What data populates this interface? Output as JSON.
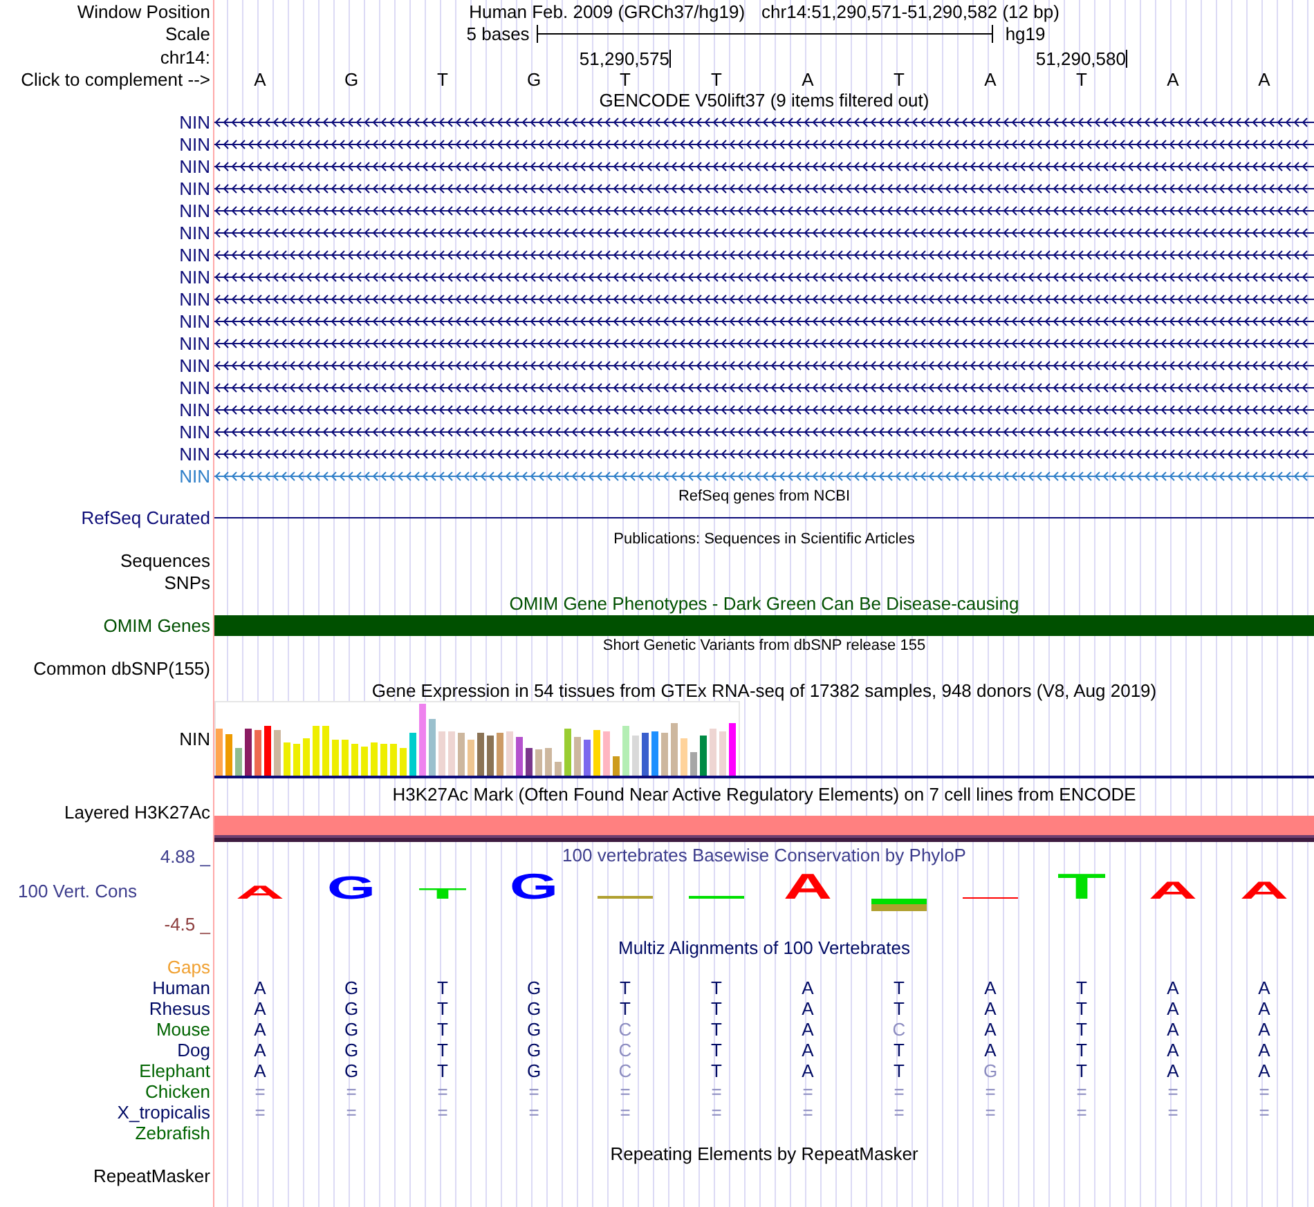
{
  "ruler": {
    "window_label": "Window Position",
    "assembly": "Human Feb. 2009 (GRCh37/hg19)",
    "range": "chr14:51,290,571-51,290,582 (12 bp)",
    "scale_label": "Scale",
    "scale_text": "5 bases",
    "scale_assembly": "hg19",
    "chrom_label": "chr14:",
    "positions": [
      "51,290,575",
      "51,290,580"
    ],
    "bases_label": "Click to complement -->",
    "bases": [
      "A",
      "G",
      "T",
      "G",
      "T",
      "T",
      "A",
      "T",
      "A",
      "T",
      "A",
      "A"
    ]
  },
  "tracks": [
    {
      "kind": "gene_stack",
      "title": "GENCODE V50lift37 (9 items filtered out)",
      "color": "#000000",
      "items": [
        {
          "label": "NIN",
          "color": "#0c0c78"
        },
        {
          "label": "NIN",
          "color": "#0c0c78"
        },
        {
          "label": "NIN",
          "color": "#0c0c78"
        },
        {
          "label": "NIN",
          "color": "#0c0c78"
        },
        {
          "label": "NIN",
          "color": "#0c0c78"
        },
        {
          "label": "NIN",
          "color": "#0c0c78"
        },
        {
          "label": "NIN",
          "color": "#0c0c78"
        },
        {
          "label": "NIN",
          "color": "#0c0c78"
        },
        {
          "label": "NIN",
          "color": "#0c0c78"
        },
        {
          "label": "NIN",
          "color": "#0c0c78"
        },
        {
          "label": "NIN",
          "color": "#0c0c78"
        },
        {
          "label": "NIN",
          "color": "#0c0c78"
        },
        {
          "label": "NIN",
          "color": "#0c0c78"
        },
        {
          "label": "NIN",
          "color": "#0c0c78"
        },
        {
          "label": "NIN",
          "color": "#0c0c78"
        },
        {
          "label": "NIN",
          "color": "#0c0c78"
        },
        {
          "label": "NIN",
          "color": "#2f7fc8"
        }
      ]
    },
    {
      "kind": "gene_line",
      "title": "RefSeq genes from NCBI",
      "label": "RefSeq Curated",
      "color": "#0c0c78"
    },
    {
      "kind": "label_stack",
      "title": "Publications: Sequences in Scientific Articles",
      "labels": [
        "Sequences",
        "SNPs"
      ],
      "color": "#000000"
    },
    {
      "kind": "feature_bar",
      "title": "OMIM Gene Phenotypes - Dark Green Can Be Disease-causing",
      "label": "OMIM Genes",
      "color": "#005000"
    },
    {
      "kind": "variants",
      "title": "Short Genetic Variants from dbSNP release 155",
      "label": "Common dbSNP(155)",
      "color": "#000000"
    },
    {
      "kind": "bar_chart",
      "title": "Gene Expression in 54 tissues from GTEx RNA-seq of 17382 samples, 948 donors (V8, Aug 2019)",
      "label": "NIN",
      "color": "#000000"
    },
    {
      "kind": "layered_signal",
      "title": "H3K27Ac Mark (Often Found Near Active Regulatory Elements) on 7 cell lines from ENCODE",
      "label": "Layered H3K27Ac",
      "color": "#000000"
    },
    {
      "kind": "logo",
      "title": "100 vertebrates Basewise Conservation by PhyloP",
      "label": "100 Vert. Cons",
      "color": "#3c3c8c",
      "ymax": "4.88 _",
      "ymin": "-4.5 _",
      "columns": [
        {
          "above": [
            {
              "kind": "letter",
              "base": "A",
              "color": "#ff0000"
            }
          ]
        },
        {
          "above": [
            {
              "kind": "letter",
              "base": "G",
              "color": "#0000ff"
            }
          ]
        },
        {
          "above": [
            {
              "kind": "letter",
              "base": "T",
              "color": "#00e000"
            }
          ]
        },
        {
          "above": [
            {
              "kind": "letter",
              "base": "G",
              "color": "#0000ff"
            }
          ]
        },
        {
          "above": [
            {
              "kind": "sliver",
              "color": "#b0a030"
            }
          ]
        },
        {
          "above": [
            {
              "kind": "sliver",
              "color": "#00e000"
            }
          ]
        },
        {
          "above": [
            {
              "kind": "letter",
              "base": "A",
              "color": "#ff0000"
            }
          ]
        },
        {
          "below": [
            {
              "kind": "sliver",
              "color": "#00e000"
            },
            {
              "kind": "sliver",
              "color": "#b0a030"
            }
          ]
        },
        {
          "above": [
            {
              "kind": "sliver",
              "color": "#ff0000"
            }
          ]
        },
        {
          "above": [
            {
              "kind": "letter",
              "base": "T",
              "color": "#00e000"
            }
          ]
        },
        {
          "above": [
            {
              "kind": "letter",
              "base": "A",
              "color": "#ff0000"
            }
          ]
        },
        {
          "above": [
            {
              "kind": "letter",
              "base": "A",
              "color": "#ff0000"
            }
          ]
        }
      ]
    },
    {
      "kind": "alignment",
      "title": "Multiz Alignments of 100 Vertebrates",
      "color": "#000a64",
      "rows": [
        {
          "label": "Gaps",
          "color": "#f0a030"
        },
        {
          "label": "Human",
          "color": "#000a64",
          "bases": [
            {
              "base": "A",
              "greyed": false
            },
            {
              "base": "G",
              "greyed": false
            },
            {
              "base": "T",
              "greyed": false
            },
            {
              "base": "G",
              "greyed": false
            },
            {
              "base": "T",
              "greyed": false
            },
            {
              "base": "T",
              "greyed": false
            },
            {
              "base": "A",
              "greyed": false
            },
            {
              "base": "T",
              "greyed": false
            },
            {
              "base": "A",
              "greyed": false
            },
            {
              "base": "T",
              "greyed": false
            },
            {
              "base": "A",
              "greyed": false
            },
            {
              "base": "A",
              "greyed": false
            }
          ]
        },
        {
          "label": "Rhesus",
          "color": "#000a64",
          "bases": [
            {
              "base": "A",
              "greyed": false
            },
            {
              "base": "G",
              "greyed": false
            },
            {
              "base": "T",
              "greyed": false
            },
            {
              "base": "G",
              "greyed": false
            },
            {
              "base": "T",
              "greyed": false
            },
            {
              "base": "T",
              "greyed": false
            },
            {
              "base": "A",
              "greyed": false
            },
            {
              "base": "T",
              "greyed": false
            },
            {
              "base": "A",
              "greyed": false
            },
            {
              "base": "T",
              "greyed": false
            },
            {
              "base": "A",
              "greyed": false
            },
            {
              "base": "A",
              "greyed": false
            }
          ]
        },
        {
          "label": "Mouse",
          "color": "#006400",
          "bases": [
            {
              "base": "A",
              "greyed": false
            },
            {
              "base": "G",
              "greyed": false
            },
            {
              "base": "T",
              "greyed": false
            },
            {
              "base": "G",
              "greyed": false
            },
            {
              "base": "C",
              "greyed": true
            },
            {
              "base": "T",
              "greyed": false
            },
            {
              "base": "A",
              "greyed": false
            },
            {
              "base": "C",
              "greyed": true
            },
            {
              "base": "A",
              "greyed": false
            },
            {
              "base": "T",
              "greyed": false
            },
            {
              "base": "A",
              "greyed": false
            },
            {
              "base": "A",
              "greyed": false
            }
          ]
        },
        {
          "label": "Dog",
          "color": "#000a64",
          "bases": [
            {
              "base": "A",
              "greyed": false
            },
            {
              "base": "G",
              "greyed": false
            },
            {
              "base": "T",
              "greyed": false
            },
            {
              "base": "G",
              "greyed": false
            },
            {
              "base": "C",
              "greyed": true
            },
            {
              "base": "T",
              "greyed": false
            },
            {
              "base": "A",
              "greyed": false
            },
            {
              "base": "T",
              "greyed": false
            },
            {
              "base": "A",
              "greyed": false
            },
            {
              "base": "T",
              "greyed": false
            },
            {
              "base": "A",
              "greyed": false
            },
            {
              "base": "A",
              "greyed": false
            }
          ]
        },
        {
          "label": "Elephant",
          "color": "#006400",
          "bases": [
            {
              "base": "A",
              "greyed": false
            },
            {
              "base": "G",
              "greyed": false
            },
            {
              "base": "T",
              "greyed": false
            },
            {
              "base": "G",
              "greyed": false
            },
            {
              "base": "C",
              "greyed": true
            },
            {
              "base": "T",
              "greyed": false
            },
            {
              "base": "A",
              "greyed": false
            },
            {
              "base": "T",
              "greyed": false
            },
            {
              "base": "G",
              "greyed": true
            },
            {
              "base": "T",
              "greyed": false
            },
            {
              "base": "A",
              "greyed": false
            },
            {
              "base": "A",
              "greyed": false
            }
          ]
        },
        {
          "label": "Chicken",
          "color": "#006400",
          "bases": [
            {
              "base": "=",
              "greyed": true
            },
            {
              "base": "=",
              "greyed": true
            },
            {
              "base": "=",
              "greyed": true
            },
            {
              "base": "=",
              "greyed": true
            },
            {
              "base": "=",
              "greyed": true
            },
            {
              "base": "=",
              "greyed": true
            },
            {
              "base": "=",
              "greyed": true
            },
            {
              "base": "=",
              "greyed": true
            },
            {
              "base": "=",
              "greyed": true
            },
            {
              "base": "=",
              "greyed": true
            },
            {
              "base": "=",
              "greyed": true
            },
            {
              "base": "=",
              "greyed": true
            }
          ]
        },
        {
          "label": "X_tropicalis",
          "color": "#000a64",
          "bases": [
            {
              "base": "=",
              "greyed": true
            },
            {
              "base": "=",
              "greyed": true
            },
            {
              "base": "=",
              "greyed": true
            },
            {
              "base": "=",
              "greyed": true
            },
            {
              "base": "=",
              "greyed": true
            },
            {
              "base": "=",
              "greyed": true
            },
            {
              "base": "=",
              "greyed": true
            },
            {
              "base": "=",
              "greyed": true
            },
            {
              "base": "=",
              "greyed": true
            },
            {
              "base": "=",
              "greyed": true
            },
            {
              "base": "=",
              "greyed": true
            },
            {
              "base": "=",
              "greyed": true
            }
          ]
        },
        {
          "label": "Zebrafish",
          "color": "#006400"
        }
      ]
    },
    {
      "kind": "repeats",
      "title": "Repeating Elements by RepeatMasker",
      "label": "RepeatMasker",
      "color": "#000000"
    }
  ]
}
